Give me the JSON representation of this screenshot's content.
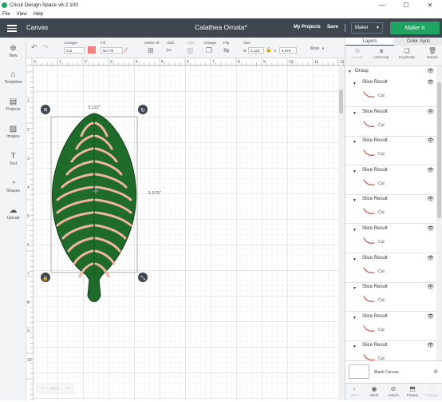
{
  "window": {
    "title": "Cricut Design Space  v6.2.100",
    "minimize": "—",
    "maximize": "☐",
    "close": "✕"
  },
  "menu": [
    "File",
    "View",
    "Help"
  ],
  "header": {
    "section": "Canvas",
    "project_name": "Calathea Ornata*",
    "my_projects": "My Projects",
    "save": "Save",
    "machine": "Maker",
    "make_it": "Make It"
  },
  "toolbar": {
    "linetype_label": "Linetype",
    "linetype_value": "Cut",
    "fill_label": "Fill",
    "fill_value": "No Fill",
    "select_all_label": "Select All",
    "edit_label": "Edit",
    "align_label": "Align",
    "arrange_label": "Arrange",
    "flip_label": "Flip",
    "size_label": "Size",
    "w_label": "W",
    "w_value": "3.122",
    "h_label": "H",
    "h_value": "5.575",
    "more_label": "More",
    "linetype_color": "#f08080"
  },
  "sidebar": [
    {
      "label": "New",
      "icon": "plus-icon"
    },
    {
      "label": "Templates",
      "icon": "shirt-icon"
    },
    {
      "label": "Projects",
      "icon": "projects-icon"
    },
    {
      "label": "Images",
      "icon": "image-icon"
    },
    {
      "label": "Text",
      "icon": "text-icon"
    },
    {
      "label": "Shapes",
      "icon": "shapes-icon"
    },
    {
      "label": "Upload",
      "icon": "upload-icon"
    }
  ],
  "canvas": {
    "width_dim": "3.122\"",
    "height_dim": "5.575\"",
    "ruler_top": [
      "0",
      "1",
      "2",
      "3",
      "4",
      "5",
      "6",
      "7",
      "8",
      "9",
      "10",
      "11",
      "12"
    ],
    "ruler_left": [
      "1",
      "2",
      "3",
      "4",
      "5",
      "6",
      "7",
      "8",
      "9",
      "10"
    ],
    "zoom": "100%",
    "leaf_color": "#1f6b2a",
    "vein_color": "#f2b5a0"
  },
  "panel": {
    "tabs": [
      "Layers",
      "Color Sync"
    ],
    "actions": [
      "Group",
      "UnGroup",
      "Duplicate",
      "Delete"
    ],
    "group_name": "Group",
    "layers": [
      {
        "name": "Slice Result",
        "type": "Cut"
      },
      {
        "name": "Slice Result",
        "type": "Cut"
      },
      {
        "name": "Slice Result",
        "type": "Cut"
      },
      {
        "name": "Slice Result",
        "type": "Cut"
      },
      {
        "name": "Slice Result",
        "type": "Cut"
      },
      {
        "name": "Slice Result",
        "type": "Cut"
      },
      {
        "name": "Slice Result",
        "type": "Cut"
      },
      {
        "name": "Slice Result",
        "type": "Cut"
      },
      {
        "name": "Slice Result",
        "type": "Cut"
      },
      {
        "name": "Slice Result",
        "type": "Cut"
      }
    ],
    "blank_canvas": "Blank Canvas",
    "bottom_actions": [
      "Slice",
      "Weld",
      "Attach",
      "Flatten",
      "Contour"
    ]
  }
}
